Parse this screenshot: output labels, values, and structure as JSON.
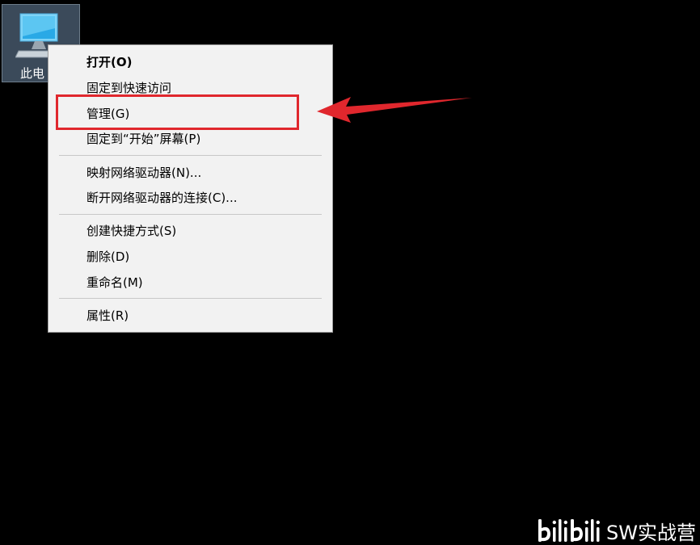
{
  "desktop": {
    "icon_label": "此电"
  },
  "context_menu": {
    "items": [
      {
        "label": "打开(O)",
        "bold": true
      },
      {
        "label": "固定到快速访问"
      },
      {
        "label": "管理(G)"
      },
      {
        "label": "固定到“开始”屏幕(P)"
      },
      {
        "label": "映射网络驱动器(N)..."
      },
      {
        "label": "断开网络驱动器的连接(C)..."
      },
      {
        "label": "创建快捷方式(S)"
      },
      {
        "label": "删除(D)"
      },
      {
        "label": "重命名(M)"
      },
      {
        "label": "属性(R)"
      }
    ]
  },
  "annotation": {
    "highlight_color": "#e0272d",
    "arrow_color": "#e0272d"
  },
  "watermark": {
    "logo": "bilibili",
    "channel": "SW实战营"
  }
}
